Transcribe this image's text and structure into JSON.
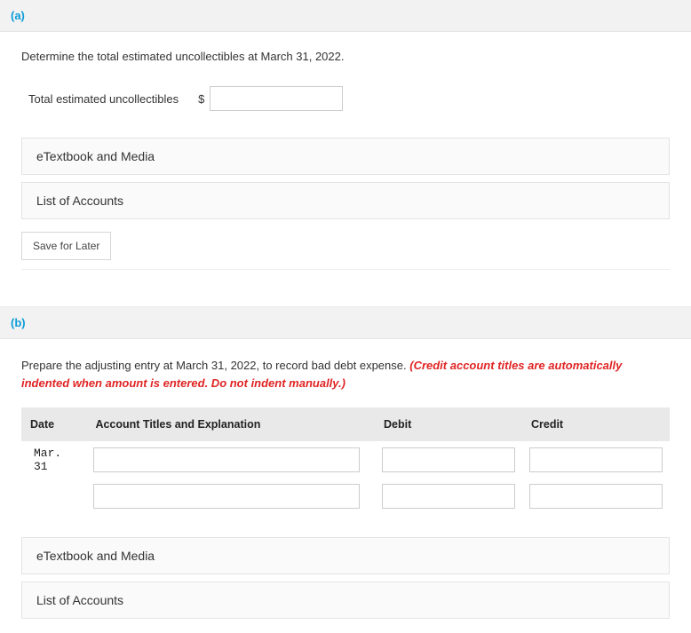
{
  "partA": {
    "label": "(a)",
    "instruction": "Determine the total estimated uncollectibles at March 31, 2022.",
    "field_label": "Total estimated uncollectibles",
    "currency_symbol": "$",
    "panel_etext": "eTextbook and Media",
    "panel_accounts": "List of Accounts",
    "save_button": "Save for Later"
  },
  "partB": {
    "label": "(b)",
    "instruction_plain": "Prepare the adjusting entry at March 31, 2022, to record bad debt expense. ",
    "instruction_italic": "(Credit account titles are automatically indented when amount is entered. Do not indent manually.)",
    "columns": {
      "date": "Date",
      "account": "Account Titles and Explanation",
      "debit": "Debit",
      "credit": "Credit"
    },
    "rows": [
      {
        "date": "Mar. 31"
      },
      {
        "date": ""
      }
    ],
    "panel_etext": "eTextbook and Media",
    "panel_accounts": "List of Accounts"
  }
}
